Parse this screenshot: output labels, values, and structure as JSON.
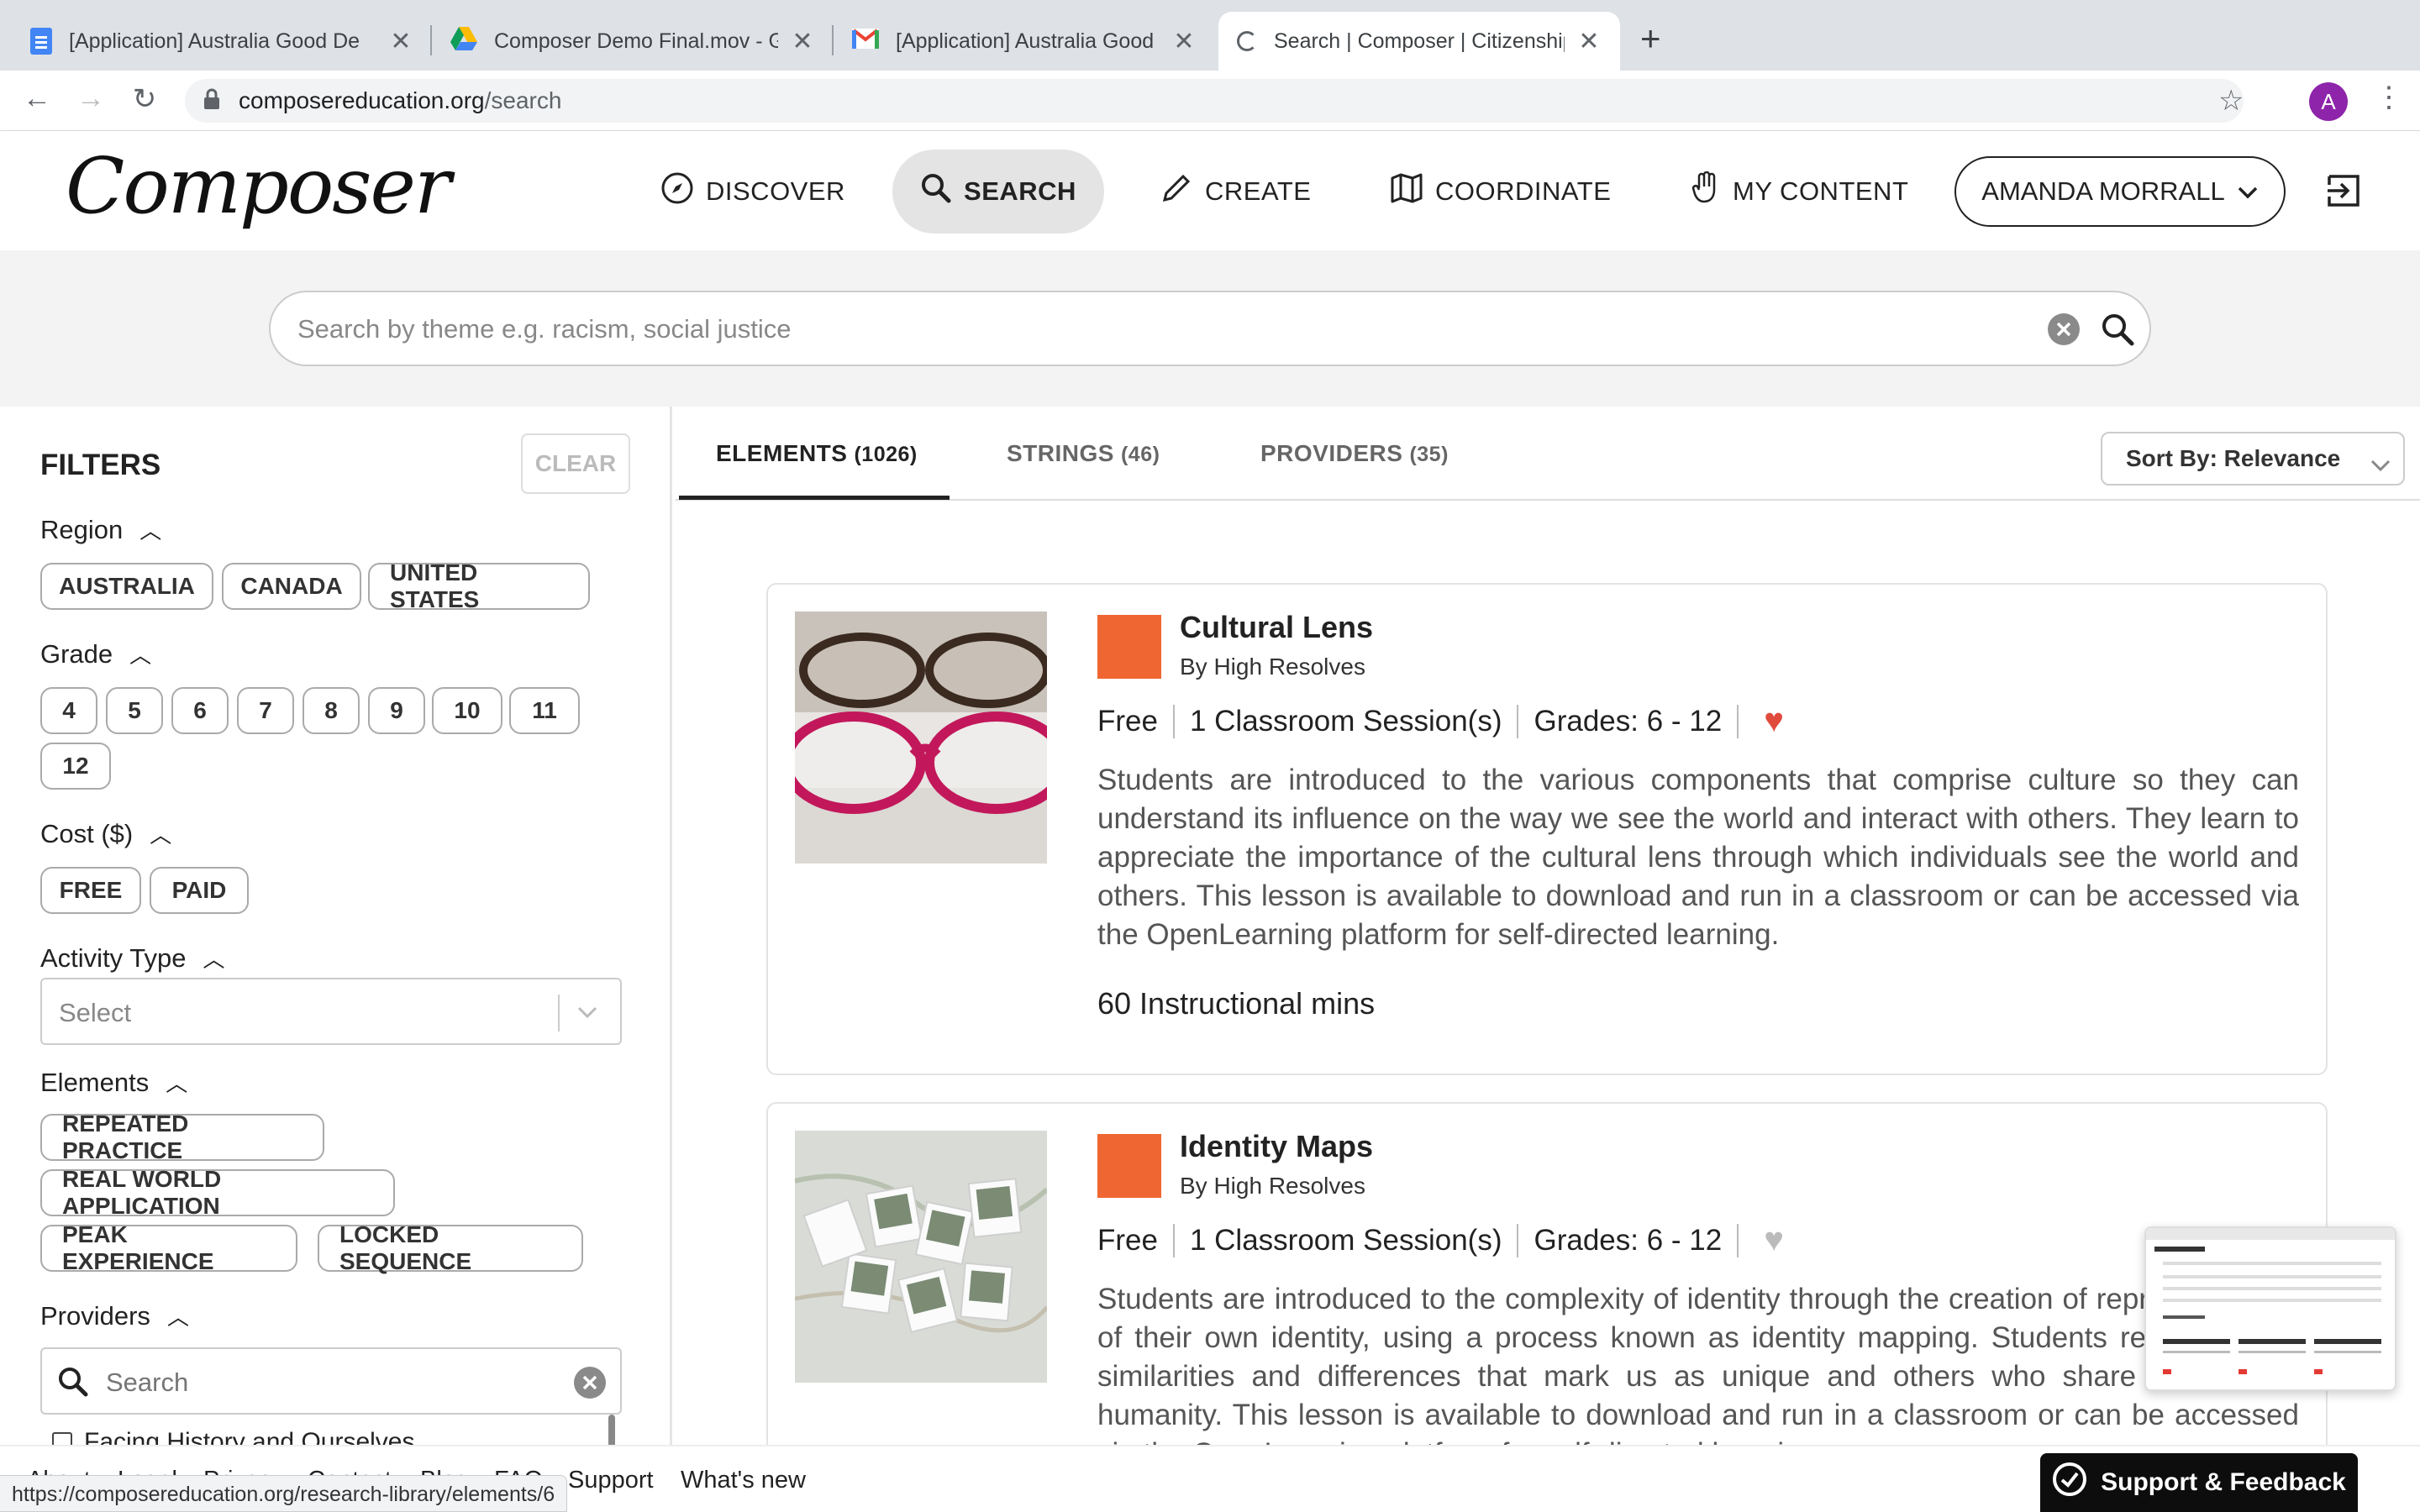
{
  "browser": {
    "tabs": [
      {
        "title": "[Application] Australia Good De",
        "icon": "docs-icon"
      },
      {
        "title": "Composer Demo Final.mov - G",
        "icon": "drive-icon"
      },
      {
        "title": "[Application] Australia Good De",
        "icon": "gmail-icon"
      },
      {
        "title": "Search | Composer | Citizenship",
        "icon": "loading-icon"
      }
    ],
    "url_domain": "composereducation.org",
    "url_path": "/search",
    "profile_initial": "A"
  },
  "header": {
    "logo": "Composer",
    "nav": [
      {
        "label": "DISCOVER",
        "icon": "compass-icon"
      },
      {
        "label": "SEARCH",
        "icon": "search-icon"
      },
      {
        "label": "CREATE",
        "icon": "pencil-icon"
      },
      {
        "label": "COORDINATE",
        "icon": "map-icon"
      },
      {
        "label": "MY CONTENT",
        "icon": "hand-icon"
      }
    ],
    "user": "AMANDA MORRALL"
  },
  "search": {
    "placeholder": "Search by theme e.g. racism, social justice"
  },
  "filters": {
    "title": "FILTERS",
    "clear": "CLEAR",
    "region": {
      "label": "Region",
      "options": [
        "AUSTRALIA",
        "CANADA",
        "UNITED STATES"
      ]
    },
    "grade": {
      "label": "Grade",
      "options": [
        "4",
        "5",
        "6",
        "7",
        "8",
        "9",
        "10",
        "11",
        "12"
      ]
    },
    "cost": {
      "label": "Cost ($)",
      "options": [
        "FREE",
        "PAID"
      ]
    },
    "activity": {
      "label": "Activity Type",
      "placeholder": "Select"
    },
    "elements": {
      "label": "Elements",
      "options": [
        "REPEATED PRACTICE",
        "REAL WORLD APPLICATION",
        "PEAK EXPERIENCE",
        "LOCKED SEQUENCE"
      ]
    },
    "providers": {
      "label": "Providers",
      "search_placeholder": "Search",
      "items": [
        "Facing History and Ourselves"
      ]
    }
  },
  "results": {
    "tabs": [
      {
        "label": "ELEMENTS",
        "count": "(1026)"
      },
      {
        "label": "STRINGS",
        "count": "(46)"
      },
      {
        "label": "PROVIDERS",
        "count": "(35)"
      }
    ],
    "sort": "Sort By: Relevance",
    "cards": [
      {
        "title": "Cultural Lens",
        "by": "By High Resolves",
        "cost": "Free",
        "sessions": "1 Classroom Session(s)",
        "grades": "Grades: 6 - 12",
        "favorited": true,
        "description": "Students are introduced to the various components that comprise culture so they can understand its influence on the way we see the world and interact with others. They learn to appreciate the importance of the cultural lens through which individuals see the world and others. This lesson is available to download and run in a classroom or can be accessed via the OpenLearning platform for self-directed learning.",
        "mins": "60 Instructional mins"
      },
      {
        "title": "Identity Maps",
        "by": "By High Resolves",
        "cost": "Free",
        "sessions": "1 Classroom Session(s)",
        "grades": "Grades: 6 - 12",
        "favorited": false,
        "description": "Students are introduced to the complexity of identity through the creation of representations of their own identity, using a process known as identity mapping. Students reflect on the similarities and differences that mark us as unique and others who share a common humanity. This lesson is available to download and run in a classroom or can be accessed via the OpenLearning platform for self-directed learning."
      }
    ]
  },
  "footer": {
    "links": [
      "About",
      "Legal",
      "Privacy",
      "Contact",
      "Blog",
      "FAQ",
      "Support",
      "What's new"
    ],
    "status_url": "https://composereducation.org/research-library/elements/6",
    "support": "Support & Feedback"
  },
  "colors": {
    "accent": "#ef6632",
    "heart_on": "#e04b3c",
    "heart_off": "#bbbbbb"
  }
}
